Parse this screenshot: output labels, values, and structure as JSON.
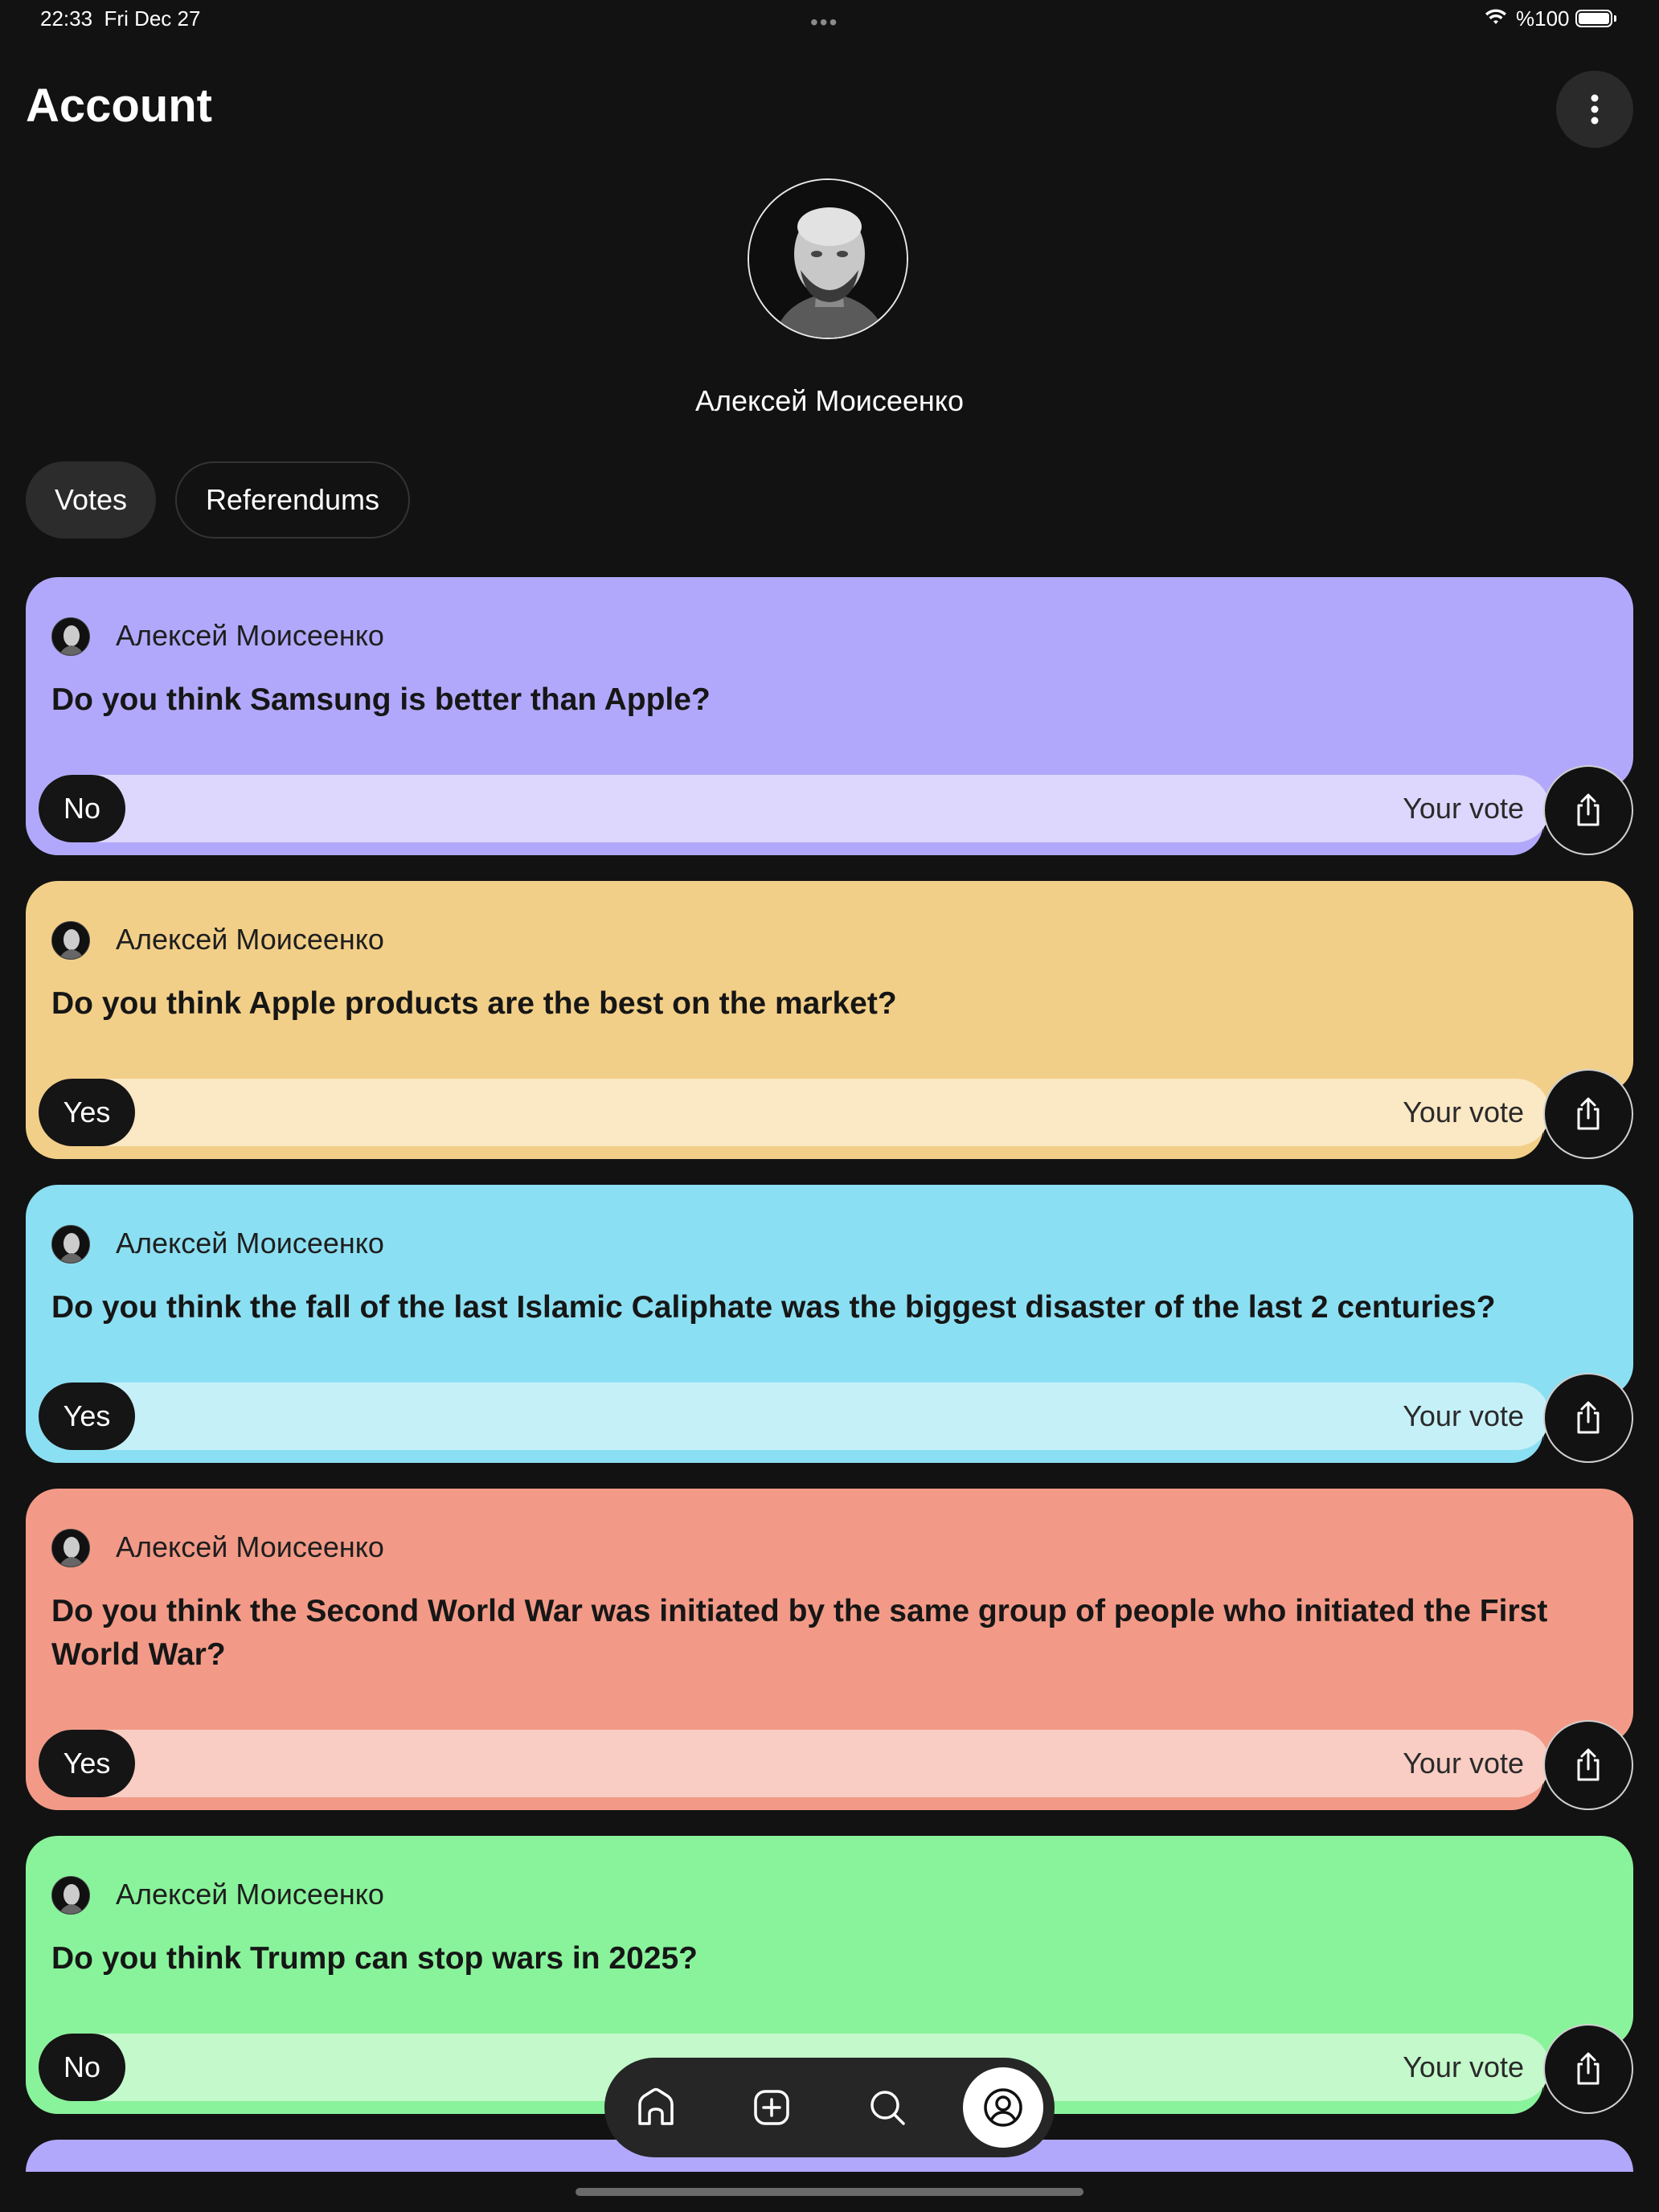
{
  "status_bar": {
    "time": "22:33",
    "date": "Fri Dec 27",
    "battery": "%100",
    "wifi_icon": "wifi-icon",
    "battery_icon": "battery-icon"
  },
  "header": {
    "title": "Account",
    "more_icon": "more-vertical-icon"
  },
  "profile": {
    "name": "Алексей Моисеенко",
    "avatar_icon": "avatar-photo"
  },
  "tabs": [
    {
      "label": "Votes",
      "active": true
    },
    {
      "label": "Referendums",
      "active": false
    }
  ],
  "votes": [
    {
      "author": "Алексей Моисеенко",
      "question": "Do you think Samsung is better than Apple?",
      "answer": "No",
      "your_vote_label": "Your vote",
      "card_color": "#b2a8fb",
      "bar_color": "#ddd7fd"
    },
    {
      "author": "Алексей Моисеенко",
      "question": "Do you think Apple products are the best on the market?",
      "answer": "Yes",
      "your_vote_label": "Your vote",
      "card_color": "#f2cf88",
      "bar_color": "#fbe8c4"
    },
    {
      "author": "Алексей Моисеенко",
      "question": "Do you think the fall of the last Islamic Caliphate was the biggest disaster of the last 2 centuries?",
      "answer": "Yes",
      "your_vote_label": "Your vote",
      "card_color": "#8bdff2",
      "bar_color": "#c6f0f8"
    },
    {
      "author": "Алексей Моисеенко",
      "question": "Do you think the Second World War was initiated by the same group of people who initiated the First World War?",
      "answer": "Yes",
      "your_vote_label": "Your vote",
      "card_color": "#f29a87",
      "bar_color": "#f9cdc3"
    },
    {
      "author": "Алексей Моисеенко",
      "question": "Do you think Trump can stop wars in 2025?",
      "answer": "No",
      "your_vote_label": "Your vote",
      "card_color": "#89f39b",
      "bar_color": "#c4f9cb"
    }
  ],
  "next_card_color": "#b2a8fb",
  "share_icon": "share-icon",
  "bottom_nav": [
    {
      "icon": "home-icon",
      "active": false
    },
    {
      "icon": "add-square-icon",
      "active": false
    },
    {
      "icon": "search-icon",
      "active": false
    },
    {
      "icon": "profile-icon",
      "active": true
    }
  ]
}
